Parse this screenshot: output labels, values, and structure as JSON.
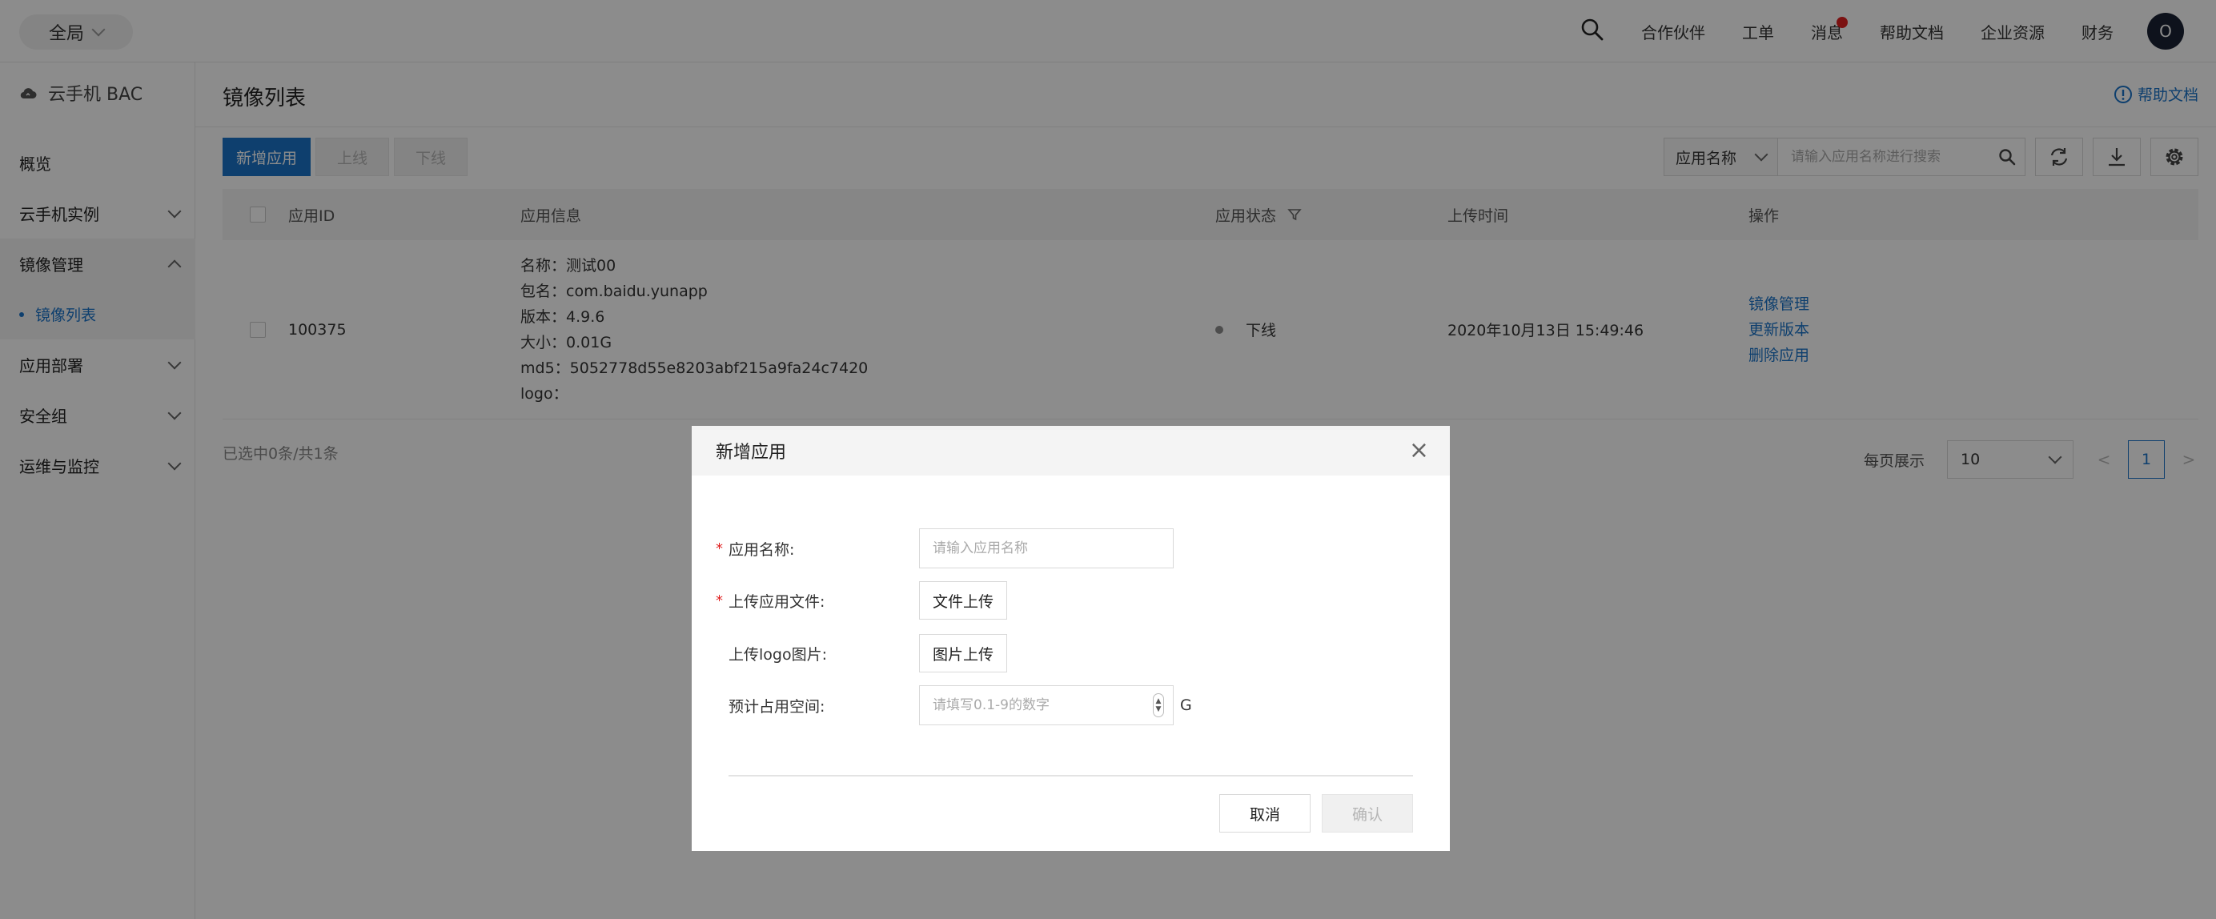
{
  "topbar": {
    "scope": "全局",
    "nav": [
      "合作伙伴",
      "工单",
      "消息",
      "帮助文档",
      "企业资源",
      "财务"
    ],
    "avatar_initial": "O"
  },
  "sidebar": {
    "brand": "云手机 BAC",
    "items": [
      {
        "label": "概览"
      },
      {
        "label": "云手机实例"
      },
      {
        "label": "镜像管理"
      },
      {
        "label": "镜像列表"
      },
      {
        "label": "应用部署"
      },
      {
        "label": "安全组"
      },
      {
        "label": "运维与监控"
      }
    ]
  },
  "page": {
    "title": "镜像列表",
    "help": "帮助文档"
  },
  "toolbar": {
    "add_label": "新增应用",
    "online_label": "上线",
    "offline_label": "下线",
    "search_field": "应用名称",
    "search_placeholder": "请输入应用名称进行搜索"
  },
  "table": {
    "headers": [
      "应用ID",
      "应用信息",
      "应用状态",
      "上传时间",
      "操作"
    ],
    "rows": [
      {
        "id": "100375",
        "info": [
          {
            "k": "名称：",
            "v": "测试00"
          },
          {
            "k": "包名：",
            "v": "com.baidu.yunapp"
          },
          {
            "k": "版本：",
            "v": "4.9.6"
          },
          {
            "k": "大小：",
            "v": "0.01G"
          },
          {
            "k": "md5：",
            "v": "5052778d55e8203abf215a9fa24c7420"
          },
          {
            "k": "logo：",
            "v": ""
          }
        ],
        "status": "下线",
        "upload_time": "2020年10月13日 15:49:46",
        "ops": [
          "镜像管理",
          "更新版本",
          "删除应用"
        ]
      }
    ]
  },
  "footer": {
    "selected": "已选中0条/共1条",
    "per_page_label": "每页展示",
    "per_page": "10",
    "prev": "<",
    "page": "1",
    "next": ">"
  },
  "modal": {
    "title": "新增应用",
    "close": "×",
    "fields": {
      "name_label": "应用名称:",
      "name_placeholder": "请输入应用名称",
      "file_label": "上传应用文件:",
      "file_button": "文件上传",
      "logo_label": "上传logo图片:",
      "logo_button": "图片上传",
      "space_label": "预计占用空间:",
      "space_placeholder": "请填写0.1-9的数字",
      "space_unit": "G"
    },
    "cancel": "取消",
    "confirm": "确认"
  },
  "colors": {
    "accent": "#1a73c8",
    "required": "#e02020",
    "overlay": "rgba(0,0,0,0.45)"
  }
}
